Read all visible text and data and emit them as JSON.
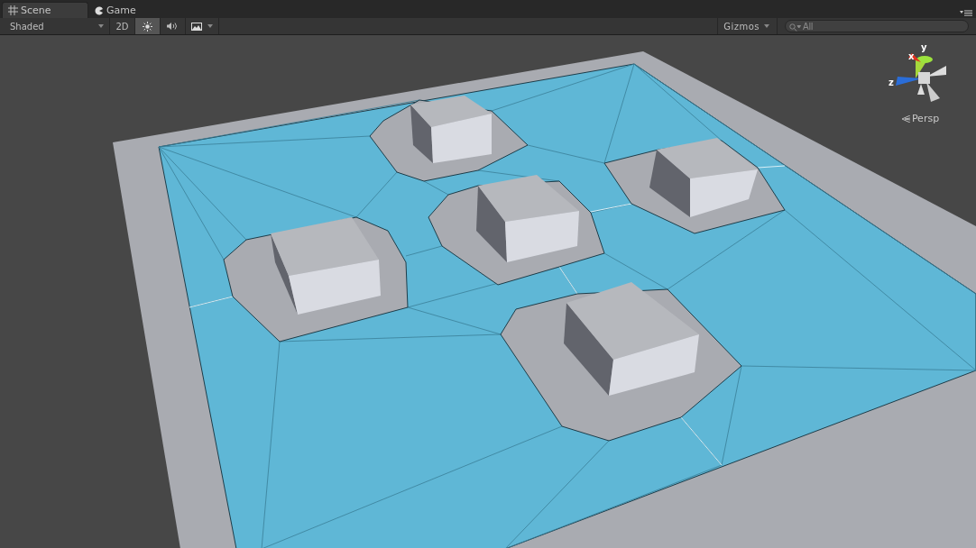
{
  "tabs": [
    {
      "label": "Scene",
      "selected": true
    },
    {
      "label": "Game",
      "selected": false
    }
  ],
  "toolbar": {
    "draw_mode": "Shaded",
    "mode_2d": {
      "label": "2D",
      "on": false
    },
    "lighting_on": true,
    "audio_on": false,
    "effects_on": false,
    "gizmos": "Gizmos",
    "search": {
      "placeholder": "All"
    }
  },
  "gizmo": {
    "axes": {
      "y": "y",
      "x": "x",
      "z": "z"
    },
    "projection": "Persp"
  }
}
